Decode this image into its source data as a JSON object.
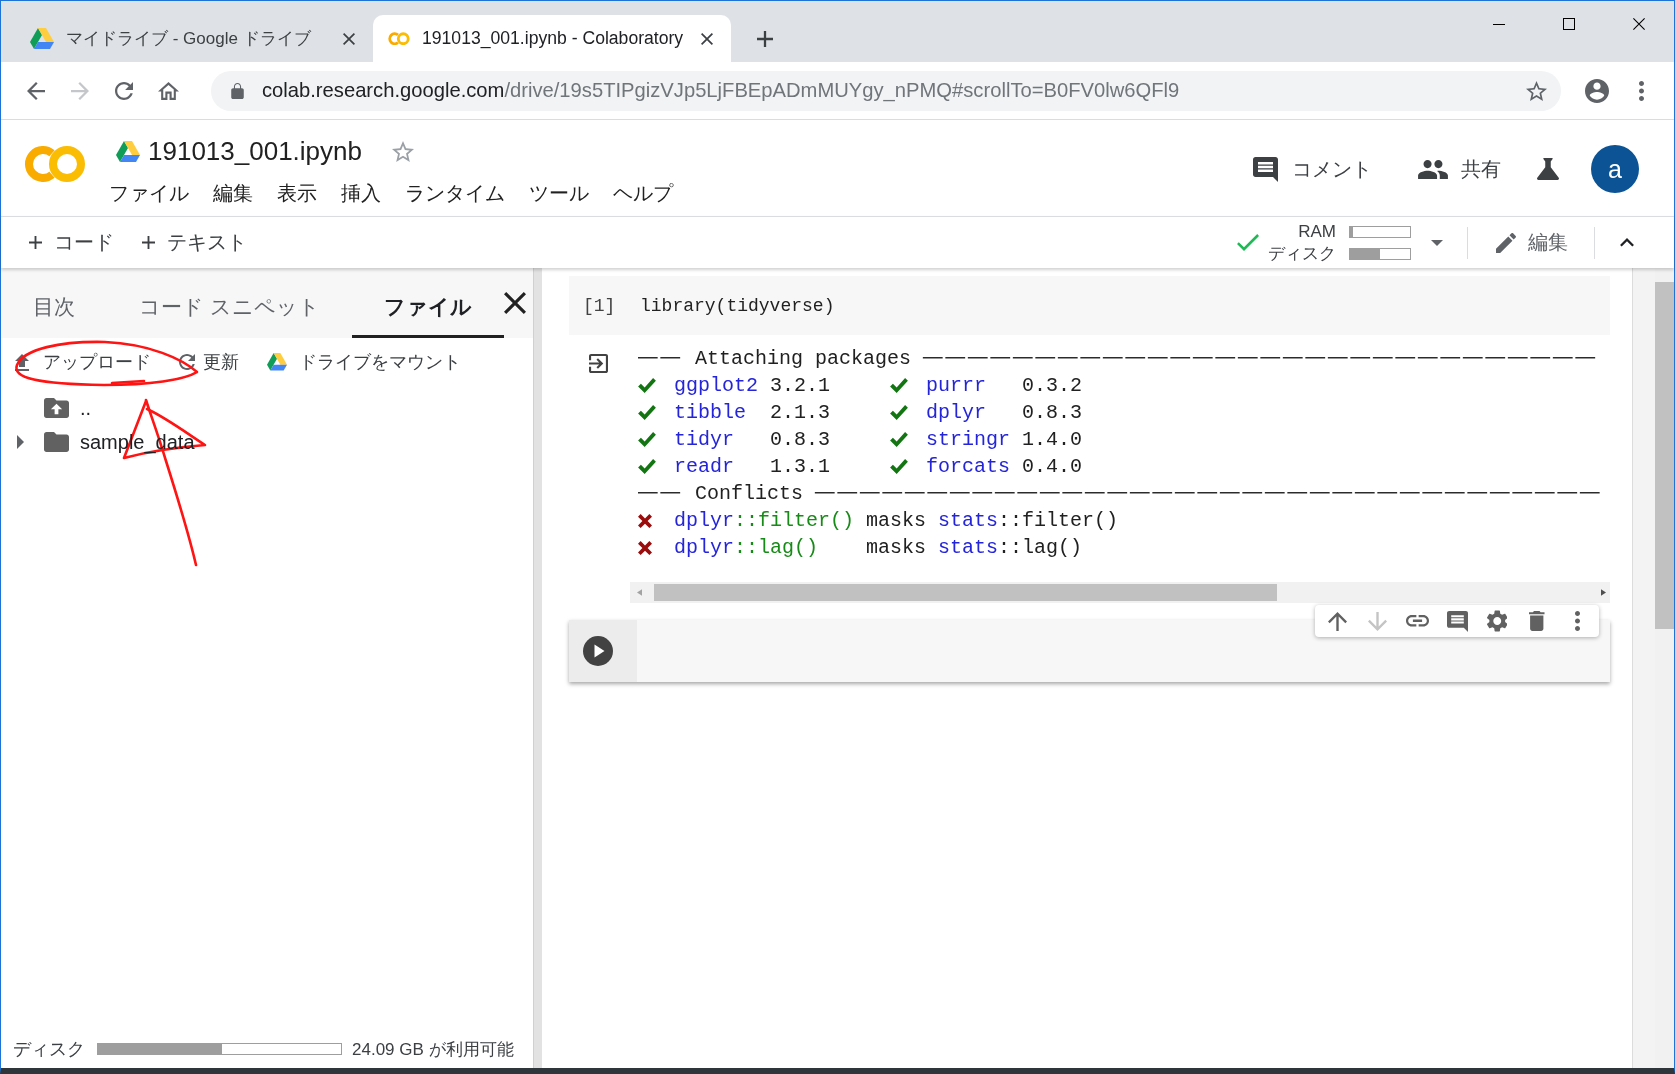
{
  "browser": {
    "tabs": [
      {
        "kind": "drive",
        "title": "マイドライブ - Google ドライブ",
        "selected": false
      },
      {
        "kind": "colab",
        "title": "191013_001.ipynb - Colaboratory",
        "selected": true
      }
    ],
    "nav": [
      {
        "kind": "back",
        "disabled": false
      },
      {
        "kind": "forward",
        "disabled": true
      },
      {
        "kind": "reload",
        "disabled": false
      },
      {
        "kind": "home",
        "disabled": false
      }
    ],
    "address": {
      "host": "colab.research.google.com",
      "path": "/drive/19s5TIPgizVJp5LjFBEpADmMUYgy_nPMQ#scrollTo=B0FV0lw6QFl9",
      "bookmarked": false
    }
  },
  "notebook": {
    "title": "191013_001.ipynb",
    "starred": false,
    "menu": [
      "ファイル",
      "編集",
      "表示",
      "挿入",
      "ランタイム",
      "ツール",
      "ヘルプ"
    ],
    "actions": [
      {
        "kind": "comment",
        "label": "コメント"
      },
      {
        "kind": "share",
        "label": "共有"
      },
      {
        "kind": "lab"
      }
    ],
    "avatar": "a"
  },
  "toolbar": {
    "insert": [
      {
        "label": "コード"
      },
      {
        "label": "テキスト"
      }
    ],
    "connected": true,
    "resources": [
      {
        "label": "RAM",
        "level": 0.05
      },
      {
        "label": "ディスク",
        "level": 0.5
      }
    ],
    "edit": "編集"
  },
  "sidebar": {
    "tabs": [
      {
        "label": "目次",
        "selected": false
      },
      {
        "label": "コード スニペット",
        "selected": false
      },
      {
        "label": "ファイル",
        "selected": true
      }
    ],
    "actions": [
      {
        "kind": "upload",
        "label": "アップロード",
        "circled": true,
        "pointed_at": true
      },
      {
        "kind": "refresh",
        "label": "更新",
        "circled": false,
        "pointed_at": false
      },
      {
        "kind": "mount",
        "label": "ドライブをマウント",
        "circled": false,
        "pointed_at": false
      }
    ],
    "files": [
      {
        "kind": "parent",
        "name": ".."
      },
      {
        "kind": "folder",
        "name": "sample_data",
        "expanded": false
      }
    ],
    "disk": {
      "label": "ディスク",
      "level": 0.51,
      "free": "24.09 GB が利用可能"
    }
  },
  "cells": [
    {
      "kind": "code",
      "focused": false,
      "execution_count": "[1]",
      "source": "library(tidyverse)",
      "output": {
        "attach_rule": "── Attaching packages ──────────────────────────────",
        "packages": [
          {
            "name": "ggplot2",
            "version": "3.2.1"
          },
          {
            "name": "purrr",
            "version": "0.3.2"
          },
          {
            "name": "tibble",
            "version": "2.1.3"
          },
          {
            "name": "dplyr",
            "version": "0.8.3"
          },
          {
            "name": "tidyr",
            "version": "0.8.3"
          },
          {
            "name": "stringr",
            "version": "1.4.0"
          },
          {
            "name": "readr",
            "version": "1.3.1"
          },
          {
            "name": "forcats",
            "version": "0.4.0"
          }
        ],
        "conflicts_rule": "── Conflicts ───────────────────────────────────",
        "conflicts": [
          {
            "package": "dplyr",
            "function": "::filter()",
            "verb": "masks",
            "masked_package": "stats",
            "masked_function": "::filter()"
          },
          {
            "package": "dplyr",
            "function": "::lag()",
            "verb": "masks",
            "masked_package": "stats",
            "masked_function": "::lag()"
          }
        ]
      }
    },
    {
      "kind": "code",
      "focused": true,
      "toolbar": [
        {
          "kind": "up",
          "disabled": false
        },
        {
          "kind": "down",
          "disabled": true
        },
        {
          "kind": "link",
          "disabled": false
        },
        {
          "kind": "comment",
          "disabled": false
        },
        {
          "kind": "settings",
          "disabled": false
        },
        {
          "kind": "delete",
          "disabled": false
        },
        {
          "kind": "more",
          "disabled": false
        }
      ]
    }
  ]
}
